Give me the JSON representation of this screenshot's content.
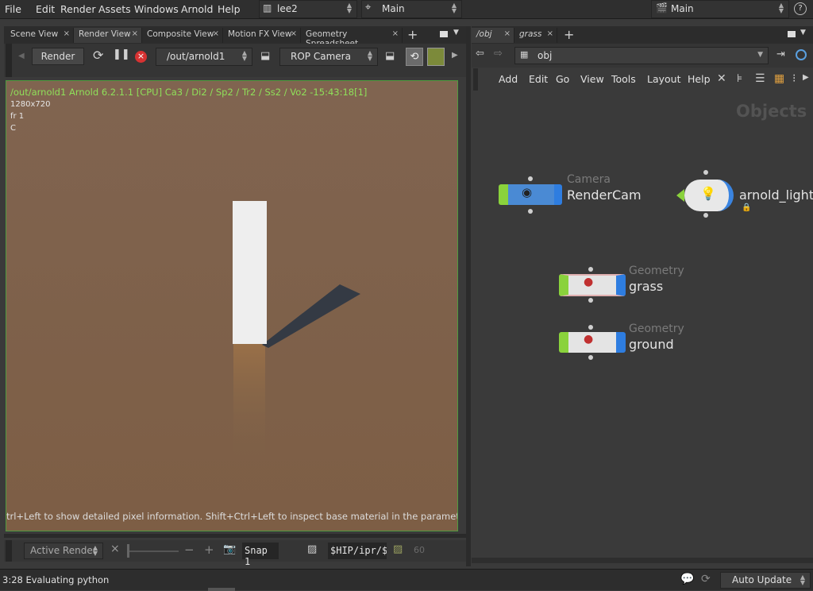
{
  "menubar": {
    "items": [
      "File",
      "Edit",
      "Render",
      "Assets",
      "Windows",
      "Arnold",
      "Help"
    ],
    "desktop": "lee2",
    "context": "Main",
    "right_context": "Main",
    "help_icon": "?"
  },
  "left_pane": {
    "tabs": [
      "Scene View",
      "Render View",
      "Composite View",
      "Motion FX View",
      "Geometry Spreadsheet"
    ],
    "active_tab": "Render View",
    "toolbar": {
      "render_button": "Render",
      "rop_path": "/out/arnold1",
      "camera": "ROP Camera"
    },
    "overlay": {
      "header": "/out/arnold1  Arnold 6.2.1.1 [CPU]  Ca3 / Di2 / Sp2 / Tr2 / Ss2 / Vo2 -15:43:18[1]",
      "resolution": "1280x720",
      "frame": "fr 1",
      "channel": "C",
      "hint": "trl+Left to show detailed pixel information. Shift+Ctrl+Left to inspect base material in the parameter dialo"
    },
    "bottom_bar": {
      "active_render": "Active Render",
      "snap_label": "Snap 1",
      "path": "$HIP/ipr/$",
      "counter": "60"
    },
    "colors": {
      "render_bg": "#7d6248",
      "frame_border": "#4f9a3f"
    }
  },
  "right_pane": {
    "tabs": [
      "/obj",
      "grass"
    ],
    "active_tab": "/obj",
    "path": "obj",
    "menu": [
      "Add",
      "Edit",
      "Go",
      "View",
      "Tools",
      "Layout",
      "Help"
    ],
    "watermark": "Objects",
    "nodes": [
      {
        "type": "Camera",
        "name": "RenderCam"
      },
      {
        "type": "",
        "name": "arnold_light"
      },
      {
        "type": "Geometry",
        "name": "grass"
      },
      {
        "type": "Geometry",
        "name": "ground"
      }
    ]
  },
  "status": {
    "message": "3:28 Evaluating python",
    "auto_update": "Auto Update"
  }
}
